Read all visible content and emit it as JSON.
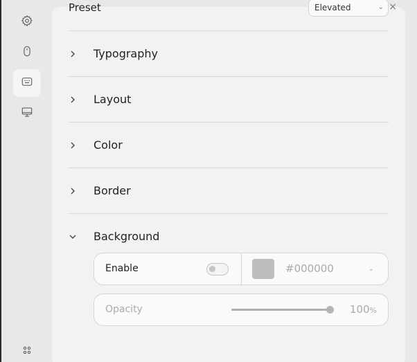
{
  "sidebar": {
    "items": [
      {
        "icon": "gear-icon",
        "active": false
      },
      {
        "icon": "mouse-icon",
        "active": false
      },
      {
        "icon": "keyboard-caption-icon",
        "active": true
      },
      {
        "icon": "monitor-icon",
        "active": false
      }
    ],
    "bottom_icon": "grid-dots-icon"
  },
  "panel": {
    "close_glyph": "×",
    "preset": {
      "label": "Preset",
      "value": "Elevated",
      "chevron": "⌄"
    },
    "sections": [
      {
        "title": "Typography",
        "expanded": false
      },
      {
        "title": "Layout",
        "expanded": false
      },
      {
        "title": "Color",
        "expanded": false
      },
      {
        "title": "Border",
        "expanded": false
      },
      {
        "title": "Background",
        "expanded": true
      }
    ],
    "background": {
      "enable_label": "Enable",
      "enabled": false,
      "color_hex": "#000000",
      "color_swatch": "#bdbdbd",
      "hex_chevron": "⌄",
      "opacity_label": "Opacity",
      "opacity_value": "100",
      "opacity_unit": "%",
      "opacity_fraction": 1.0
    }
  }
}
